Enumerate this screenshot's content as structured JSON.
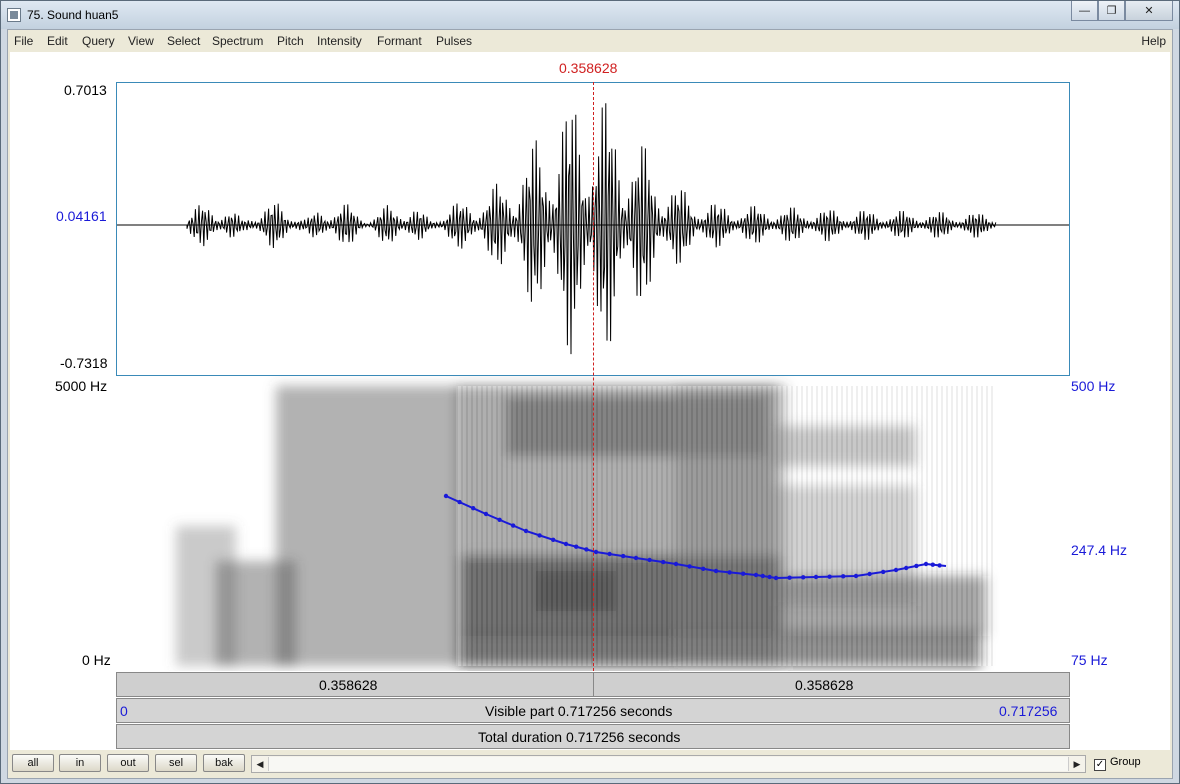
{
  "window": {
    "title": "75. Sound huan5",
    "min_icon": "minimize-icon",
    "max_icon": "restore-icon",
    "close_icon": "close-icon"
  },
  "menu": [
    "File",
    "Edit",
    "Query",
    "View",
    "Select",
    "Spectrum",
    "Pitch",
    "Intensity",
    "Formant",
    "Pulses"
  ],
  "menu_help": "Help",
  "cursor": {
    "time_label": "0.358628"
  },
  "waveform": {
    "max": "0.7013",
    "mid": "0.04161",
    "min": "-0.7318"
  },
  "spectrogram": {
    "freq_max": "5000 Hz",
    "freq_min": "0 Hz"
  },
  "pitch": {
    "max": "500 Hz",
    "mid": "247.4 Hz",
    "min": "75 Hz",
    "color": "#1a1ad8"
  },
  "selection_bar": {
    "left": "0.358628",
    "right": "0.358628"
  },
  "visible_bar": {
    "start": "0",
    "label": "Visible part 0.717256 seconds",
    "end": "0.717256"
  },
  "total_bar": {
    "label": "Total duration 0.717256 seconds"
  },
  "buttons": [
    "all",
    "in",
    "out",
    "sel",
    "bak"
  ],
  "group": {
    "label": "Group",
    "checked": true
  }
}
